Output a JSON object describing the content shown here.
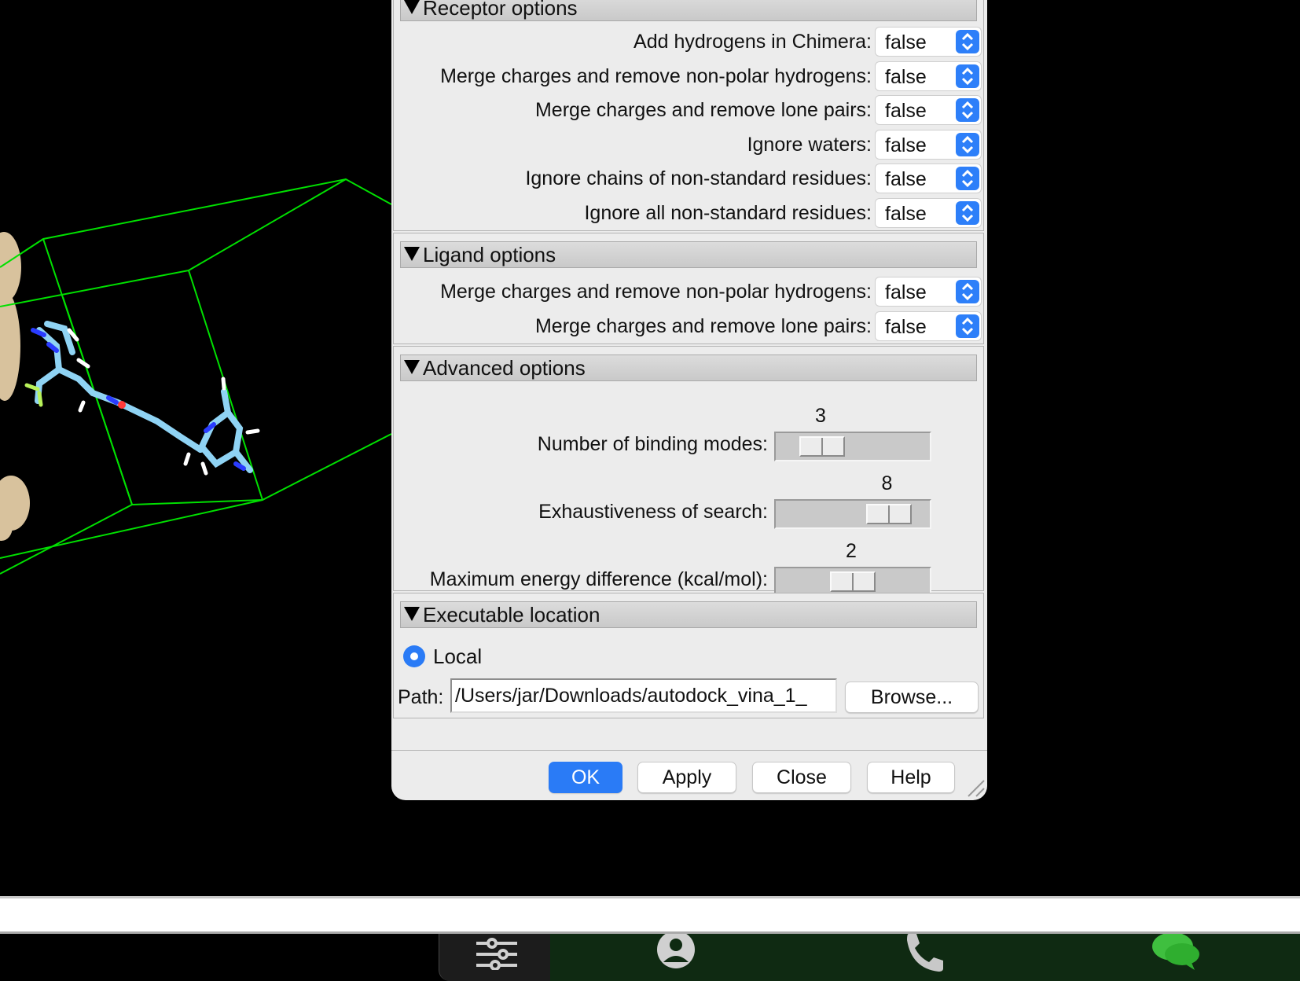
{
  "receptor": {
    "title": "Receptor options",
    "options": [
      {
        "label": "Add hydrogens in Chimera:",
        "value": "false"
      },
      {
        "label": "Merge charges and remove non-polar hydrogens:",
        "value": "false"
      },
      {
        "label": "Merge charges and remove lone pairs:",
        "value": "false"
      },
      {
        "label": "Ignore waters:",
        "value": "false"
      },
      {
        "label": "Ignore chains of non-standard residues:",
        "value": "false"
      },
      {
        "label": "Ignore all non-standard residues:",
        "value": "false"
      }
    ]
  },
  "ligand": {
    "title": "Ligand options",
    "options": [
      {
        "label": "Merge charges and remove non-polar hydrogens:",
        "value": "false"
      },
      {
        "label": "Merge charges and remove lone pairs:",
        "value": "false"
      }
    ]
  },
  "advanced": {
    "title": "Advanced options",
    "sliders": [
      {
        "label": "Number of binding modes:",
        "value": "3",
        "level": 0.2
      },
      {
        "label": "Exhaustiveness of search:",
        "value": "8",
        "level": 0.85
      },
      {
        "label": "Maximum energy difference (kcal/mol):",
        "value": "2",
        "level": 0.5
      }
    ]
  },
  "executable": {
    "title": "Executable location",
    "local_label": "Local",
    "path_label": "Path:",
    "path_value": "/Users/jar/Downloads/autodock_vina_1_",
    "browse_label": "Browse..."
  },
  "buttons": {
    "ok": "OK",
    "apply": "Apply",
    "close": "Close",
    "help": "Help"
  },
  "colors": {
    "accent": "#2a7bf6",
    "box": "#00e000",
    "molecule": "#8fd3f4",
    "surface": "#d8c29d"
  },
  "dock_icons": [
    "sliders-icon",
    "user-icon",
    "phone-icon",
    "chat-icon"
  ]
}
